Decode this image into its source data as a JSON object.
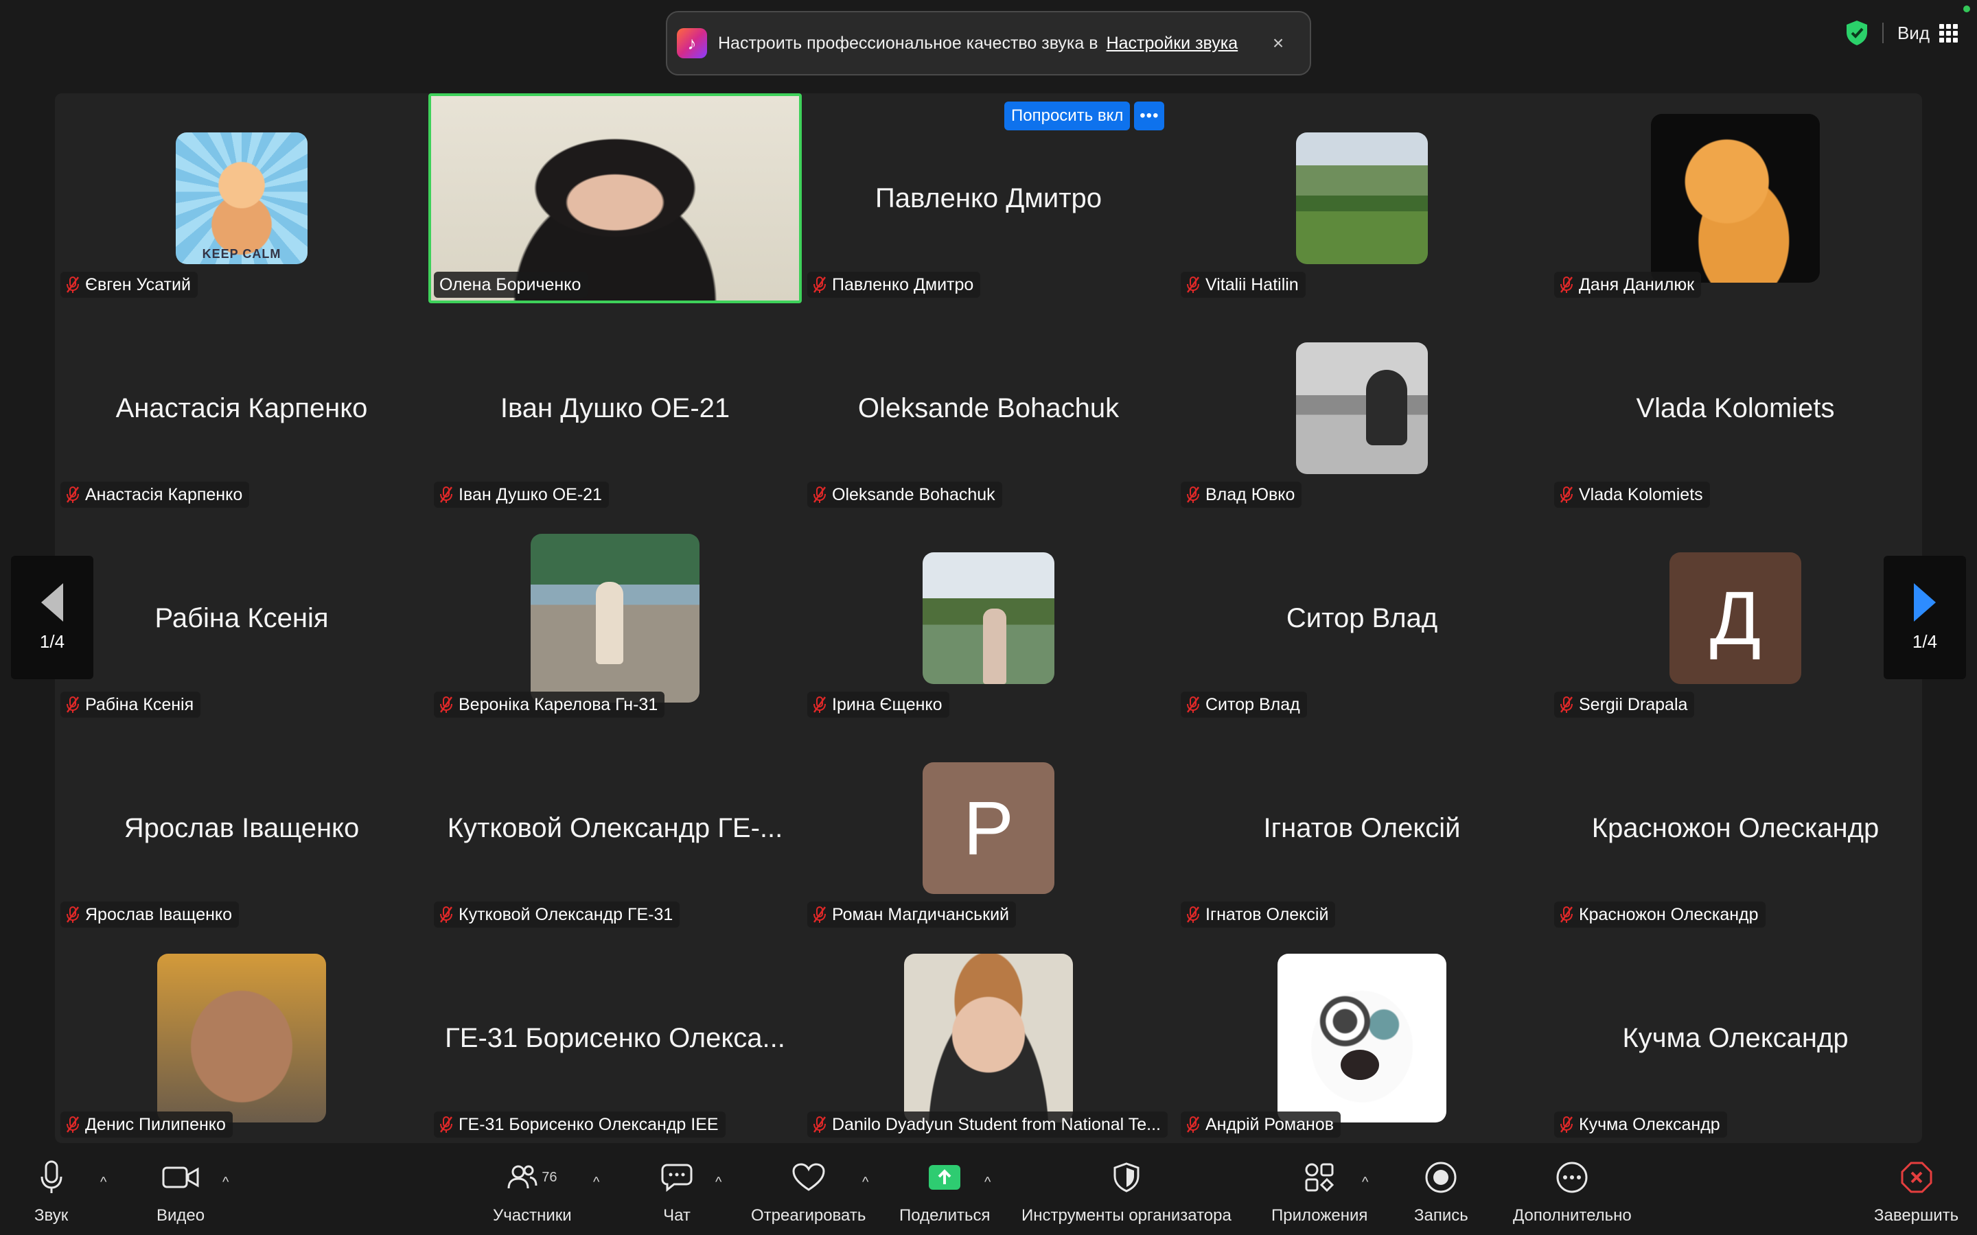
{
  "notification": {
    "text": "Настроить профессиональное качество звука в",
    "link": "Настройки звука",
    "close": "×"
  },
  "topbar": {
    "view_label": "Вид"
  },
  "ask_button": {
    "label": "Попросить вкл",
    "more": "•••"
  },
  "pager": {
    "left": "1/4",
    "right": "1/4"
  },
  "tiles": [
    {
      "label": "Євген Усатий",
      "big": ""
    },
    {
      "label": "Олена Бориченко",
      "big": ""
    },
    {
      "label": "Павленко Дмитро",
      "big": "Павленко Дмитро"
    },
    {
      "label": "Vitalii Hatilin",
      "big": ""
    },
    {
      "label": "Даня Данилюк",
      "big": ""
    },
    {
      "label": "Анастасія Карпенко",
      "big": "Анастасія Карпенко"
    },
    {
      "label": "Іван Душко ОЕ-21",
      "big": "Іван Душко ОЕ-21"
    },
    {
      "label": "Oleksande Bohachuk",
      "big": "Oleksande Bohachuk"
    },
    {
      "label": "Влад Ювко",
      "big": ""
    },
    {
      "label": "Vlada Kolomiets",
      "big": "Vlada Kolomiets"
    },
    {
      "label": "Рабіна Ксенія",
      "big": "Рабіна Ксенія"
    },
    {
      "label": "Вероніка Карелова Гн-31",
      "big": ""
    },
    {
      "label": "Ірина Єщенко",
      "big": ""
    },
    {
      "label": "Ситор Влад",
      "big": "Ситор Влад"
    },
    {
      "label": "Sergii Drapala",
      "big": "",
      "avatar_letter": "Д"
    },
    {
      "label": "Ярослав Іващенко",
      "big": "Ярослав Іващенко"
    },
    {
      "label": "Кутковой Олександр ГЕ-31",
      "big": "Кутковой Олександр ГЕ-..."
    },
    {
      "label": "Роман Магдичанський",
      "big": "",
      "avatar_letter": "P"
    },
    {
      "label": "Ігнатов Олексій",
      "big": "Ігнатов Олексій"
    },
    {
      "label": "Красножон Олескандр",
      "big": "Красножон Олескандр"
    },
    {
      "label": "Денис Пилипенко",
      "big": ""
    },
    {
      "label": "ГЕ-31 Борисенко Олександр IEE",
      "big": "ГЕ-31 Борисенко Олекса..."
    },
    {
      "label": "Danilo Dyadyun Student from National Te...",
      "big": ""
    },
    {
      "label": "Андрій Романов",
      "big": ""
    },
    {
      "label": "Кучма Олександр",
      "big": "Кучма Олександр"
    }
  ],
  "photo_text": {
    "keep_calm": "KEEP CALM"
  },
  "toolbar": {
    "audio": "Звук",
    "video": "Видео",
    "participants": "Участники",
    "participants_count": "76",
    "chat": "Чат",
    "react": "Отреагировать",
    "share": "Поделиться",
    "host_tools": "Инструменты организатора",
    "apps": "Приложения",
    "record": "Запись",
    "more": "Дополнительно",
    "end": "Завершить"
  },
  "colors": {
    "active_speaker": "#3ed15a",
    "accent": "#0e72ed",
    "mute_red": "#e02828",
    "end_red": "#e53e3e"
  }
}
